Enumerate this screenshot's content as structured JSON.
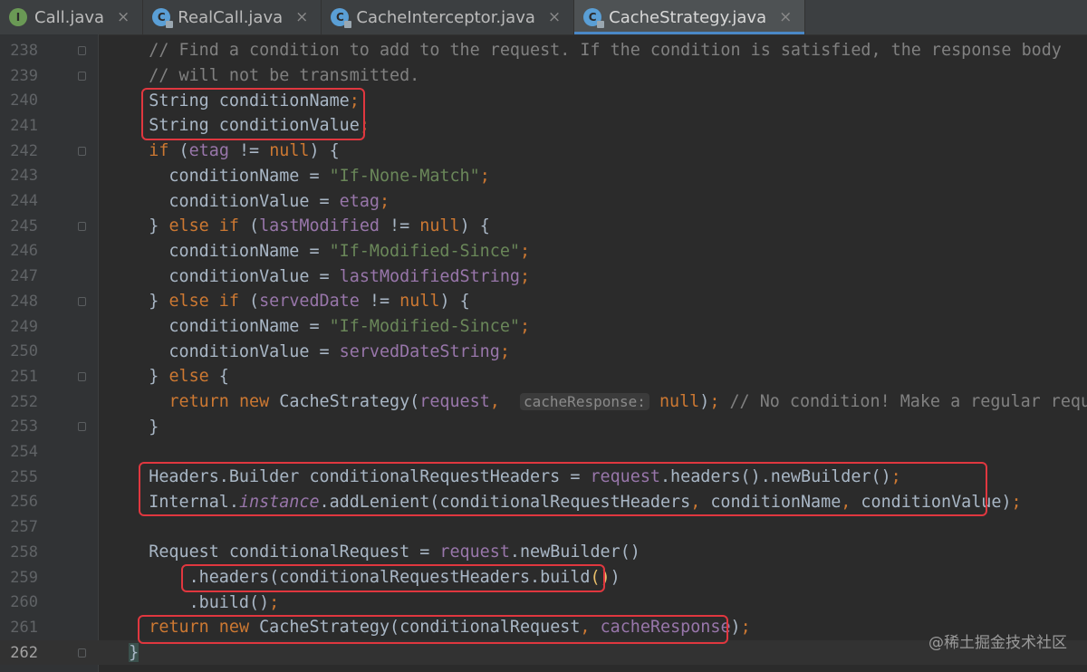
{
  "tabs": [
    {
      "label": "Call.java",
      "icon": "interface-icon",
      "glyph": "I",
      "active": false
    },
    {
      "label": "RealCall.java",
      "icon": "class-icon",
      "glyph": "C",
      "active": false
    },
    {
      "label": "CacheInterceptor.java",
      "icon": "class-icon",
      "glyph": "C",
      "active": false
    },
    {
      "label": "CacheStrategy.java",
      "icon": "class-icon",
      "glyph": "C",
      "active": true
    }
  ],
  "tab_close_glyph": "×",
  "current_line": "262",
  "lines": [
    {
      "n": "238",
      "html": "    <span class=\"cm\">// Find a condition to add to the request. If the condition is satisfied, the response body</span>"
    },
    {
      "n": "239",
      "html": "    <span class=\"cm\">// will not be transmitted.</span>"
    },
    {
      "n": "240",
      "html": "    String conditionName<span class=\"kw\">;</span>"
    },
    {
      "n": "241",
      "html": "    String conditionValue<span class=\"kw\">;</span>"
    },
    {
      "n": "242",
      "html": "    <span class=\"kw\">if</span> (<span class=\"fld\">etag</span> != <span class=\"kw\">null</span>) {"
    },
    {
      "n": "243",
      "html": "      conditionName = <span class=\"str\">\"If-None-Match\"</span><span class=\"kw\">;</span>"
    },
    {
      "n": "244",
      "html": "      conditionValue = <span class=\"fld\">etag</span><span class=\"kw\">;</span>"
    },
    {
      "n": "245",
      "html": "    } <span class=\"kw\">else if</span> (<span class=\"fld\">lastModified</span> != <span class=\"kw\">null</span>) {"
    },
    {
      "n": "246",
      "html": "      conditionName = <span class=\"str\">\"If-Modified-Since\"</span><span class=\"kw\">;</span>"
    },
    {
      "n": "247",
      "html": "      conditionValue = <span class=\"fld\">lastModifiedString</span><span class=\"kw\">;</span>"
    },
    {
      "n": "248",
      "html": "    } <span class=\"kw\">else if</span> (<span class=\"fld\">servedDate</span> != <span class=\"kw\">null</span>) {"
    },
    {
      "n": "249",
      "html": "      conditionName = <span class=\"str\">\"If-Modified-Since\"</span><span class=\"kw\">;</span>"
    },
    {
      "n": "250",
      "html": "      conditionValue = <span class=\"fld\">servedDateString</span><span class=\"kw\">;</span>"
    },
    {
      "n": "251",
      "html": "    } <span class=\"kw\">else</span> {"
    },
    {
      "n": "252",
      "html": "      <span class=\"kw\">return new</span> CacheStrategy(<span class=\"fld\">request</span><span class=\"kw\">,</span>  <span class=\"hint\">cacheResponse:</span> <span class=\"kw\">null</span>)<span class=\"kw\">;</span> <span class=\"cm\">// No condition! Make a regular request.</span>"
    },
    {
      "n": "253",
      "html": "    }"
    },
    {
      "n": "254",
      "html": ""
    },
    {
      "n": "255",
      "html": "    Headers.Builder conditionalRequestHeaders = <span class=\"fld\">request</span>.headers().newBuilder()<span class=\"kw\">;</span>"
    },
    {
      "n": "256",
      "html": "    Internal.<span class=\"it\">instance</span>.addLenient(conditionalRequestHeaders<span class=\"kw\">,</span> conditionName<span class=\"kw\">,</span> conditionValue)<span class=\"kw\">;</span>"
    },
    {
      "n": "257",
      "html": ""
    },
    {
      "n": "258",
      "html": "    Request conditionalRequest = <span class=\"fld\">request</span>.newBuilder()"
    },
    {
      "n": "259",
      "html": "        .headers(conditionalRequestHeaders.build<span class=\"ybr\">()</span>)"
    },
    {
      "n": "260",
      "html": "        .build()<span class=\"kw\">;</span>"
    },
    {
      "n": "261",
      "html": "    <span class=\"kw\">return new</span> CacheStrategy(conditionalRequest<span class=\"kw\">,</span> <span class=\"fld\">cacheResponse</span>)<span class=\"kw\">;</span>"
    },
    {
      "n": "262",
      "html": "  <span class=\"bracehl\">}</span>"
    }
  ],
  "watermark": "@稀土掘金技术社区"
}
